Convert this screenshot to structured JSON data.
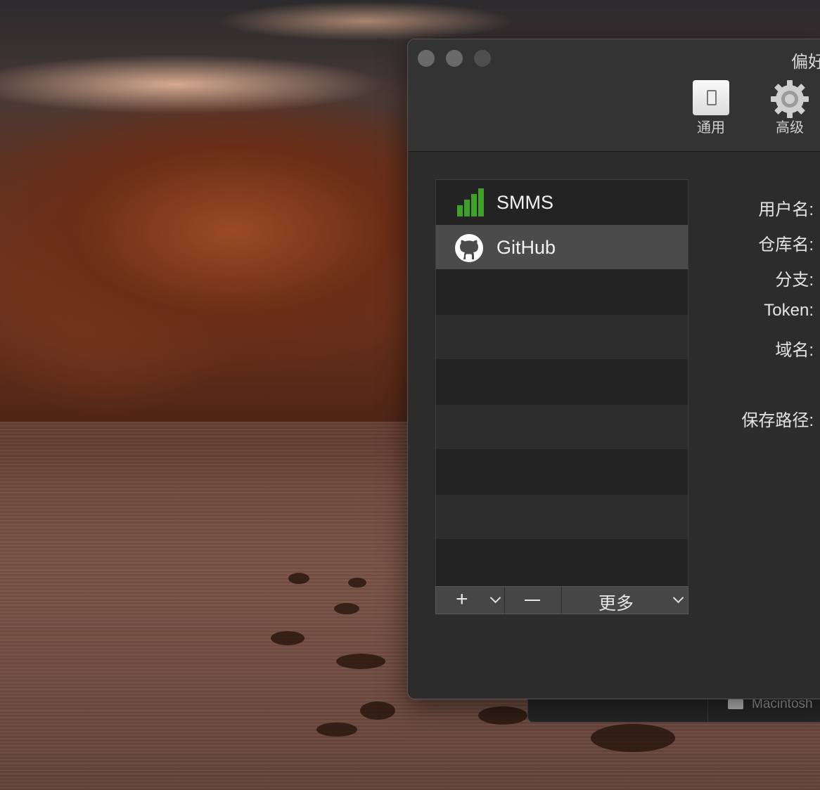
{
  "window": {
    "title": "偏好",
    "toolbar": [
      {
        "label": "通用",
        "icon": "switch-icon"
      },
      {
        "label": "高级",
        "icon": "gear-icon"
      }
    ]
  },
  "servers": {
    "items": [
      {
        "label": "SMMS",
        "icon": "signal-bars-icon",
        "selected": false
      },
      {
        "label": "GitHub",
        "icon": "github-icon",
        "selected": true
      }
    ],
    "toolbar": {
      "add_label": "+",
      "remove_label": "—",
      "more_label": "更多"
    }
  },
  "form": {
    "username_label": "用户名:",
    "repo_label": "仓库名:",
    "branch_label": "分支:",
    "token_label": "Token:",
    "domain_label": "域名:",
    "save_path_label": "保存路径:"
  },
  "background_window": {
    "drive_label": "Macintosh"
  },
  "colors": {
    "accent_green": "#3fa12a",
    "window_bg": "#2c2c2c",
    "selected_row": "#4b4b4b"
  }
}
